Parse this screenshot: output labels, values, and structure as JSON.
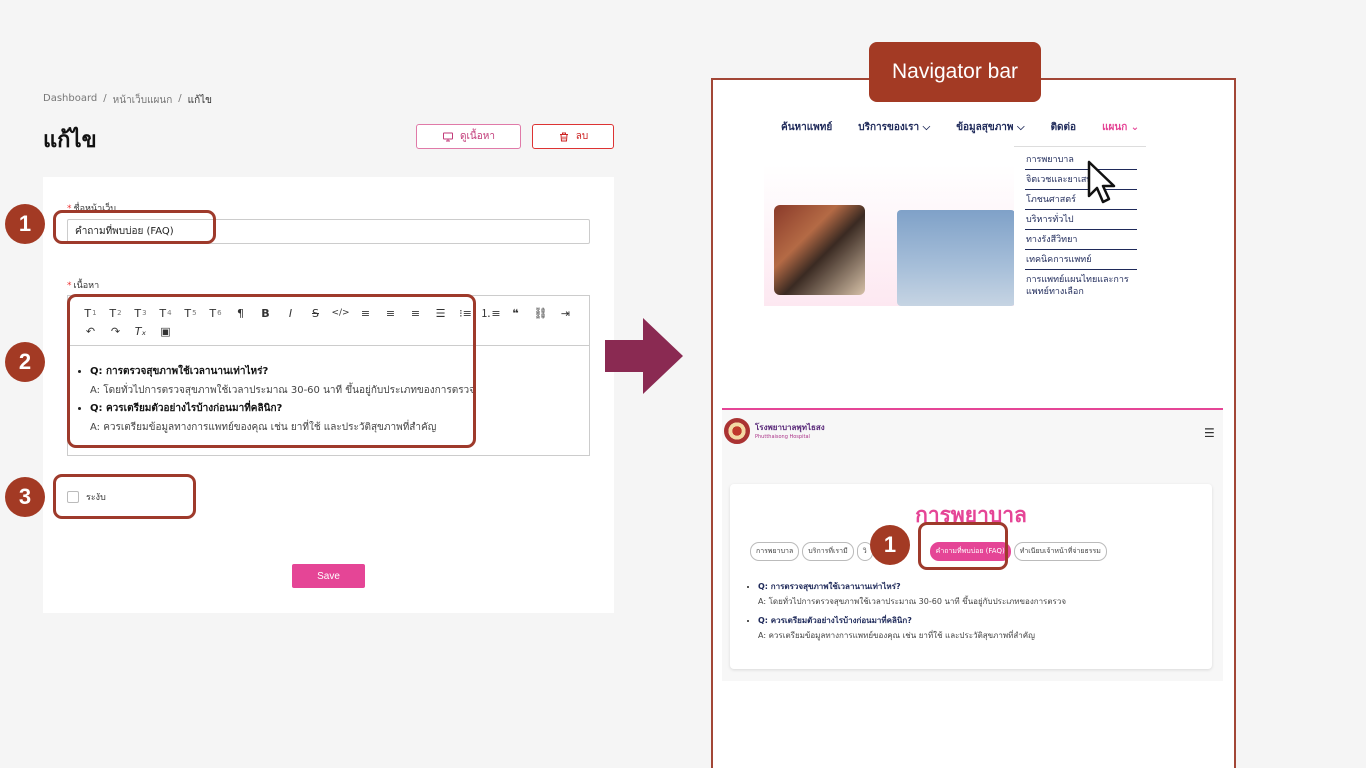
{
  "breadcrumb": {
    "items": [
      "Dashboard",
      "/",
      "หน้าเว็บแผนก",
      "/",
      "แก้ไข"
    ]
  },
  "page": {
    "title": "แก้ไข"
  },
  "actions": {
    "view_label": "ดูเนื้อหา",
    "delete_label": "ลบ"
  },
  "form": {
    "name_label": "ชื่อหน้าเว็บ",
    "name_value": "คำถามที่พบบ่อย (FAQ)",
    "content_label": "เนื้อหา",
    "toolbar": {
      "row1": [
        "T1",
        "T2",
        "T3",
        "T4",
        "T5",
        "T6",
        "¶",
        "B",
        "I",
        "S",
        "</>",
        "align-left",
        "align-center",
        "align-right",
        "align-justify",
        "bullet-list",
        "numbered-list",
        "quote"
      ],
      "row2": [
        "link",
        "embed",
        "undo",
        "redo",
        "clear-format",
        "image"
      ]
    },
    "faq": [
      {
        "q": "Q: การตรวจสุขภาพใช้เวลานานเท่าไหร่?",
        "a": "A: โดยทั่วไปการตรวจสุขภาพใช้เวลาประมาณ 30-60 นาที ขึ้นอยู่กับประเภทของการตรวจ"
      },
      {
        "q": "Q: ควรเตรียมตัวอย่างไรบ้างก่อนมาที่คลินิก?",
        "a": "A: ควรเตรียมข้อมูลทางการแพทย์ของคุณ เช่น ยาที่ใช้ และประวัติสุขภาพที่สำคัญ"
      }
    ],
    "suspend_label": "ระงับ",
    "save_label": "Save"
  },
  "annotations": {
    "one": "1",
    "two": "2",
    "three": "3",
    "preview_one": "1"
  },
  "navigator": {
    "tag": "Navigator bar",
    "links": [
      "ค้นหาแพทย์",
      "บริการของเรา ⌵",
      "ข้อมูลสุขภาพ ⌵",
      "ติดต่อ",
      "แผนก ⌄"
    ],
    "dropdown": [
      "การพยาบาล",
      "จิตเวชและยาเสพติด",
      "โภชนศาสตร์",
      "บริหารทั่วไป",
      "ทางรังสีวิทยา",
      "เทคนิคการแพทย์",
      "การแพทย์แผนไทยและการแพทย์ทางเลือก"
    ]
  },
  "preview": {
    "hospital_name": "โรงพยาบาลพุทไธสง",
    "hospital_sub": "Phutthaisong Hospital",
    "title": "การพยาบาล",
    "tabs": [
      "การพยาบาล",
      "บริการที่เรามี",
      "วิ",
      "คำถามที่พบบ่อย (FAQ)",
      "ทำเนียบเจ้าหน้าที่จ่ายธรรม"
    ],
    "faq": [
      {
        "q": "Q: การตรวจสุขภาพใช้เวลานานเท่าไหร่?",
        "a": "A: โดยทั่วไปการตรวจสุขภาพใช้เวลาประมาณ 30-60 นาที ขึ้นอยู่กับประเภทของการตรวจ"
      },
      {
        "q": "Q: ควรเตรียมตัวอย่างไรบ้างก่อนมาที่คลินิก?",
        "a": "A: ควรเตรียมข้อมูลทางการแพทย์ของคุณ เช่น ยาที่ใช้ และประวัติสุขภาพที่สำคัญ"
      }
    ]
  }
}
